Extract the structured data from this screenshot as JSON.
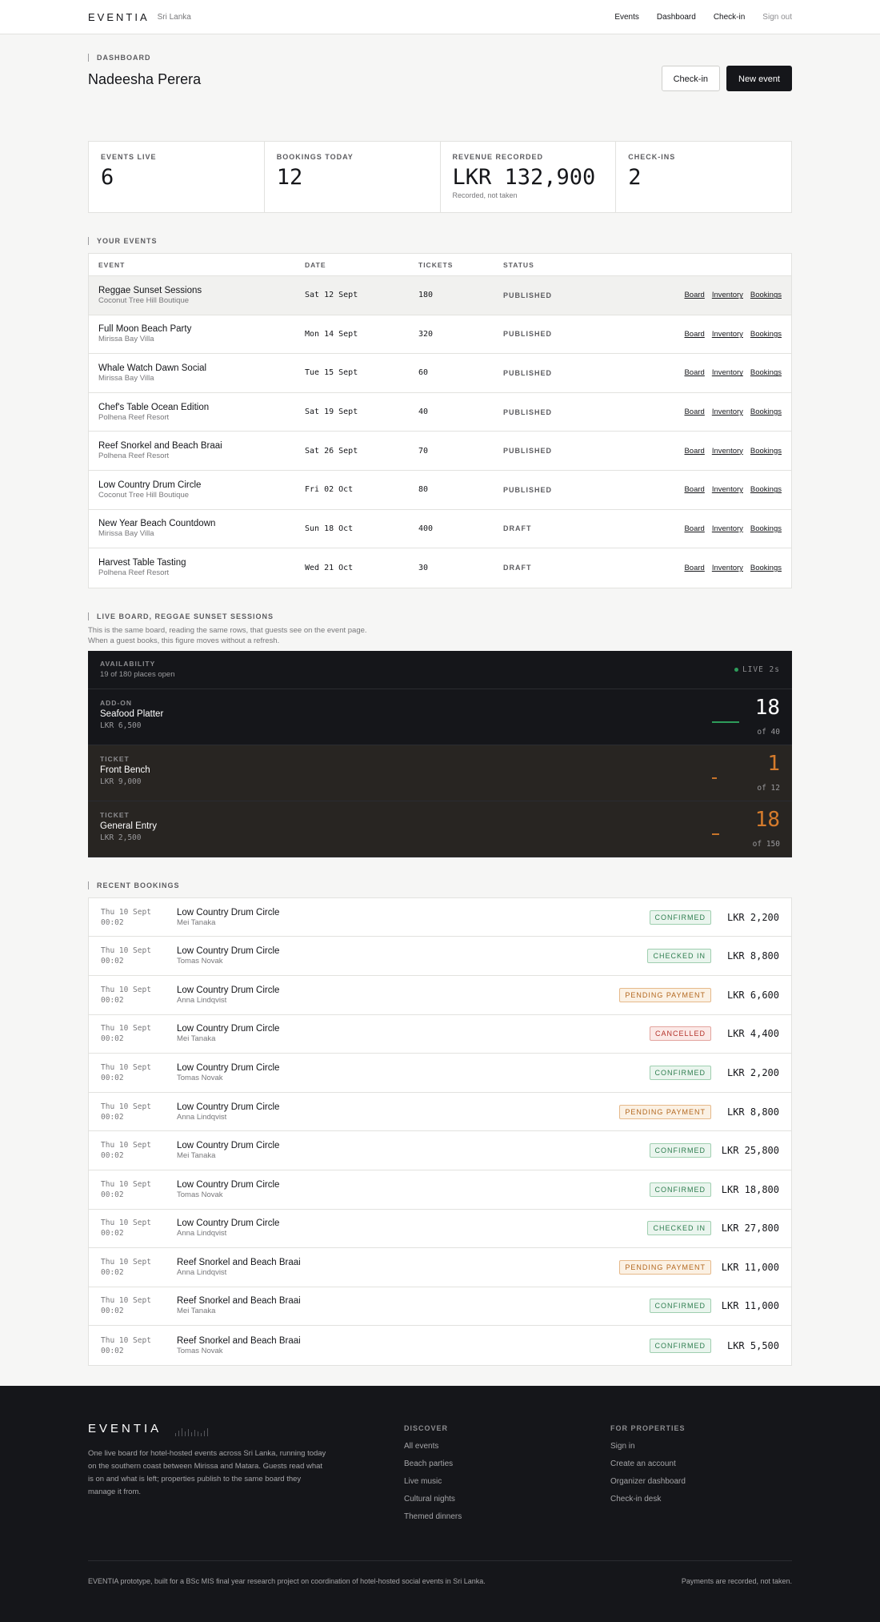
{
  "header": {
    "brand": "EVENTIA",
    "region": "Sri Lanka",
    "nav": [
      "Events",
      "Dashboard",
      "Check-in",
      "Sign out"
    ]
  },
  "dashboard": {
    "label": "DASHBOARD",
    "user_name": "Nadeesha Perera",
    "checkin_button": "Check-in",
    "new_event_button": "New event"
  },
  "stats": [
    {
      "label": "EVENTS LIVE",
      "value": "6",
      "note": ""
    },
    {
      "label": "BOOKINGS TODAY",
      "value": "12",
      "note": ""
    },
    {
      "label": "REVENUE RECORDED",
      "value": "LKR 132,900",
      "note": "Recorded, not taken"
    },
    {
      "label": "CHECK-INS",
      "value": "2",
      "note": ""
    }
  ],
  "events": {
    "label": "YOUR EVENTS",
    "columns": [
      "EVENT",
      "DATE",
      "TICKETS",
      "STATUS"
    ],
    "action_labels": [
      "Board",
      "Inventory",
      "Bookings"
    ],
    "rows": [
      {
        "name": "Reggae Sunset Sessions",
        "venue": "Coconut Tree Hill Boutique",
        "date": "Sat 12 Sept",
        "tickets": "180",
        "status": "PUBLISHED"
      },
      {
        "name": "Full Moon Beach Party",
        "venue": "Mirissa Bay Villa",
        "date": "Mon 14 Sept",
        "tickets": "320",
        "status": "PUBLISHED"
      },
      {
        "name": "Whale Watch Dawn Social",
        "venue": "Mirissa Bay Villa",
        "date": "Tue 15 Sept",
        "tickets": "60",
        "status": "PUBLISHED"
      },
      {
        "name": "Chef's Table Ocean Edition",
        "venue": "Polhena Reef Resort",
        "date": "Sat 19 Sept",
        "tickets": "40",
        "status": "PUBLISHED"
      },
      {
        "name": "Reef Snorkel and Beach Braai",
        "venue": "Polhena Reef Resort",
        "date": "Sat 26 Sept",
        "tickets": "70",
        "status": "PUBLISHED"
      },
      {
        "name": "Low Country Drum Circle",
        "venue": "Coconut Tree Hill Boutique",
        "date": "Fri 02 Oct",
        "tickets": "80",
        "status": "PUBLISHED"
      },
      {
        "name": "New Year Beach Countdown",
        "venue": "Mirissa Bay Villa",
        "date": "Sun 18 Oct",
        "tickets": "400",
        "status": "DRAFT"
      },
      {
        "name": "Harvest Table Tasting",
        "venue": "Polhena Reef Resort",
        "date": "Wed 21 Oct",
        "tickets": "30",
        "status": "DRAFT"
      }
    ]
  },
  "live_board": {
    "label": "LIVE BOARD, REGGAE SUNSET SESSIONS",
    "desc_line1": "This is the same board, reading the same rows, that guests see on the event page.",
    "desc_line2": "When a guest books, this figure moves without a refresh.",
    "availability_label": "AVAILABILITY",
    "availability_text": "19 of 180 places open",
    "live_text": "LIVE 2s",
    "live_color": "#2e9d5b",
    "items": [
      {
        "kind": "ADD-ON",
        "name": "Seafood Platter",
        "price": "LKR 6,500",
        "remaining": "18",
        "of": "of 40",
        "level": 0.45,
        "color": "#2e9d5b",
        "num_color": "#ffffff"
      },
      {
        "kind": "TICKET",
        "name": "Front Bench",
        "price": "LKR 9,000",
        "remaining": "1",
        "of": "of 12",
        "level": 0.08,
        "color": "#c8742a",
        "num_color": "#d57b2c"
      },
      {
        "kind": "TICKET",
        "name": "General Entry",
        "price": "LKR 2,500",
        "remaining": "18",
        "of": "of 150",
        "level": 0.12,
        "color": "#c8742a",
        "num_color": "#d57b2c"
      }
    ]
  },
  "bookings": {
    "label": "RECENT BOOKINGS",
    "rows": [
      {
        "day": "Thu 10 Sept",
        "time": "00:02",
        "event": "Low Country Drum Circle",
        "guest": "Mei Tanaka",
        "status": "CONFIRMED",
        "amount": "LKR 2,200"
      },
      {
        "day": "Thu 10 Sept",
        "time": "00:02",
        "event": "Low Country Drum Circle",
        "guest": "Tomas Novak",
        "status": "CHECKED IN",
        "amount": "LKR 8,800"
      },
      {
        "day": "Thu 10 Sept",
        "time": "00:02",
        "event": "Low Country Drum Circle",
        "guest": "Anna Lindqvist",
        "status": "PENDING PAYMENT",
        "amount": "LKR 6,600"
      },
      {
        "day": "Thu 10 Sept",
        "time": "00:02",
        "event": "Low Country Drum Circle",
        "guest": "Mei Tanaka",
        "status": "CANCELLED",
        "amount": "LKR 4,400"
      },
      {
        "day": "Thu 10 Sept",
        "time": "00:02",
        "event": "Low Country Drum Circle",
        "guest": "Tomas Novak",
        "status": "CONFIRMED",
        "amount": "LKR 2,200"
      },
      {
        "day": "Thu 10 Sept",
        "time": "00:02",
        "event": "Low Country Drum Circle",
        "guest": "Anna Lindqvist",
        "status": "PENDING PAYMENT",
        "amount": "LKR 8,800"
      },
      {
        "day": "Thu 10 Sept",
        "time": "00:02",
        "event": "Low Country Drum Circle",
        "guest": "Mei Tanaka",
        "status": "CONFIRMED",
        "amount": "LKR 25,800"
      },
      {
        "day": "Thu 10 Sept",
        "time": "00:02",
        "event": "Low Country Drum Circle",
        "guest": "Tomas Novak",
        "status": "CONFIRMED",
        "amount": "LKR 18,800"
      },
      {
        "day": "Thu 10 Sept",
        "time": "00:02",
        "event": "Low Country Drum Circle",
        "guest": "Anna Lindqvist",
        "status": "CHECKED IN",
        "amount": "LKR 27,800"
      },
      {
        "day": "Thu 10 Sept",
        "time": "00:02",
        "event": "Reef Snorkel and Beach Braai",
        "guest": "Anna Lindqvist",
        "status": "PENDING PAYMENT",
        "amount": "LKR 11,000"
      },
      {
        "day": "Thu 10 Sept",
        "time": "00:02",
        "event": "Reef Snorkel and Beach Braai",
        "guest": "Mei Tanaka",
        "status": "CONFIRMED",
        "amount": "LKR 11,000"
      },
      {
        "day": "Thu 10 Sept",
        "time": "00:02",
        "event": "Reef Snorkel and Beach Braai",
        "guest": "Tomas Novak",
        "status": "CONFIRMED",
        "amount": "LKR 5,500"
      }
    ],
    "status_colors": {
      "CONFIRMED": {
        "fg": "#2e7d4f",
        "bg": "#eaf5ee",
        "border": "#9fcfb0"
      },
      "CHECKED IN": {
        "fg": "#2e7d4f",
        "bg": "#eaf5ee",
        "border": "#9fcfb0"
      },
      "PENDING PAYMENT": {
        "fg": "#b3671e",
        "bg": "#fbf1e4",
        "border": "#e6b98a"
      },
      "CANCELLED": {
        "fg": "#b4322a",
        "bg": "#fbe9e7",
        "border": "#e3a49e"
      }
    }
  },
  "footer": {
    "brand": "EVENTIA",
    "description": "One live board for hotel-hosted events across Sri Lanka, running today on the southern coast between Mirissa and Matara. Guests read what is on and what is left; properties publish to the same board they manage it from.",
    "discover_heading": "DISCOVER",
    "discover_links": [
      "All events",
      "Beach parties",
      "Live music",
      "Cultural nights",
      "Themed dinners"
    ],
    "properties_heading": "FOR PROPERTIES",
    "properties_links": [
      "Sign in",
      "Create an account",
      "Organizer dashboard",
      "Check-in desk"
    ],
    "bottom_left": "EVENTIA prototype, built for a BSc MIS final year research project on coordination of hotel-hosted social events in Sri Lanka.",
    "bottom_right": "Payments are recorded, not taken."
  }
}
